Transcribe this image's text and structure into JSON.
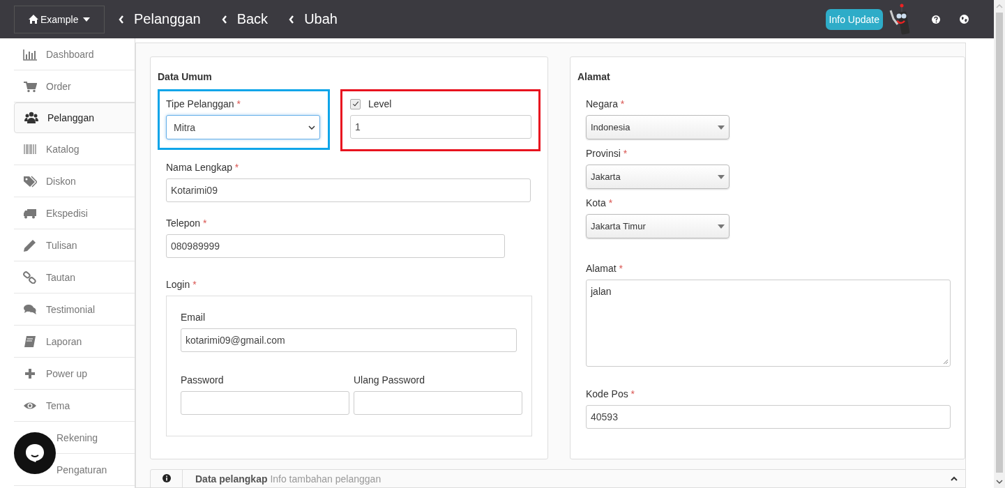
{
  "topbar": {
    "site": "Example",
    "breadcrumbs": [
      "Pelanggan",
      "Back",
      "Ubah"
    ],
    "info_button": "Info Update"
  },
  "sidebar": {
    "items": [
      {
        "label": "Dashboard",
        "selected": false
      },
      {
        "label": "Order",
        "selected": false
      },
      {
        "label": "Pelanggan",
        "selected": true
      },
      {
        "label": "Katalog",
        "selected": false
      },
      {
        "label": "Diskon",
        "selected": false
      },
      {
        "label": "Ekspedisi",
        "selected": false
      },
      {
        "label": "Tulisan",
        "selected": false
      },
      {
        "label": "Tautan",
        "selected": false
      },
      {
        "label": "Testimonial",
        "selected": false
      },
      {
        "label": "Laporan",
        "selected": false
      },
      {
        "label": "Power up",
        "selected": false
      },
      {
        "label": "Tema",
        "selected": false
      },
      {
        "label": "Rekening",
        "selected": false
      },
      {
        "label": "Pengaturan",
        "selected": false
      }
    ]
  },
  "data_umum": {
    "title": "Data Umum",
    "tipe_pelanggan": {
      "label": "Tipe Pelanggan",
      "mark": "*",
      "value": "Mitra"
    },
    "level": {
      "label": "Level",
      "checked": true,
      "value": "1"
    },
    "nama_lengkap": {
      "label": "Nama Lengkap",
      "mark": "*",
      "value": "Kotarimi09"
    },
    "telepon": {
      "label": "Telepon",
      "mark": "*",
      "value": "080989999"
    },
    "login": {
      "label": "Login",
      "mark": "*",
      "email": {
        "label": "Email",
        "value": "kotarimi09@gmail.com"
      },
      "password": {
        "label": "Password"
      },
      "ulang_password": {
        "label": "Ulang Password"
      }
    }
  },
  "alamat_card": {
    "title": "Alamat",
    "selects": [
      {
        "label": "Negara",
        "mark": "*",
        "value": "Indonesia"
      },
      {
        "label": "Provinsi",
        "mark": "*",
        "value": "Jakarta"
      },
      {
        "label": "Kota",
        "mark": "*",
        "value": "Jakarta Timur"
      }
    ],
    "alamat": {
      "label": "Alamat",
      "mark": "*",
      "value": "jalan"
    },
    "kode_pos": {
      "label": "Kode Pos",
      "mark": "*",
      "value": "40593"
    }
  },
  "data_pelengkap": {
    "title": "Data pelangkap",
    "subtitle": "Info tambahan pelanggan"
  }
}
